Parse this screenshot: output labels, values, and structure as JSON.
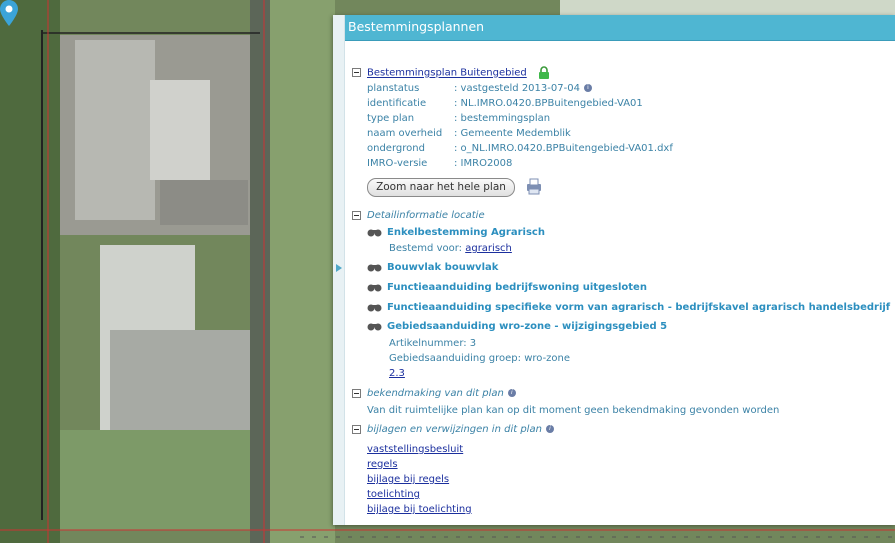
{
  "panel": {
    "title": "Bestemmingsplannen",
    "plan": {
      "name": "Bestemmingsplan Buitengebied",
      "fields": [
        {
          "key": "planstatus",
          "value": ": vastgesteld 2013-07-04"
        },
        {
          "key": "identificatie",
          "value": ": NL.IMRO.0420.BPBuitengebied-VA01"
        },
        {
          "key": "type plan",
          "value": ": bestemmingsplan"
        },
        {
          "key": "naam overheid",
          "value": ": Gemeente Medemblik"
        },
        {
          "key": "ondergrond",
          "value": ": o_NL.IMRO.0420.BPBuitengebied-VA01.dxf"
        },
        {
          "key": "IMRO-versie",
          "value": ": IMRO2008"
        }
      ],
      "zoom_button": "Zoom naar het hele plan"
    },
    "detail": {
      "header": "Detailinformatie locatie",
      "items": [
        {
          "title": "Enkelbestemming Agrarisch"
        },
        {
          "title": "Bouwvlak bouwvlak"
        },
        {
          "title": "Functieaanduiding bedrijfswoning uitgesloten"
        },
        {
          "title": "Functieaanduiding specifieke vorm van agrarisch - bedrijfskavel agrarisch handelsbedrijf"
        },
        {
          "title": "Gebiedsaanduiding wro-zone - wijzigingsgebied 5"
        }
      ],
      "bestemd_voor_label": "Bestemd voor:",
      "bestemd_voor_link": "agrarisch",
      "artikelnummer": "Artikelnummer: 3",
      "groep": "Gebiedsaanduiding groep: wro-zone",
      "link_23": "2.3"
    },
    "bekendmaking": {
      "header": "bekendmaking van dit plan",
      "text": "Van dit ruimtelijke plan kan op dit moment geen bekendmaking gevonden worden"
    },
    "bijlagen": {
      "header": "bijlagen en verwijzingen in dit plan",
      "links": [
        "vaststellingsbesluit",
        "regels",
        "bijlage bij regels",
        "toelichting",
        "bijlage bij toelichting"
      ]
    }
  },
  "colors": {
    "header": "#4fb6d2",
    "text": "#3b82a6",
    "link": "#1b2f9e"
  }
}
